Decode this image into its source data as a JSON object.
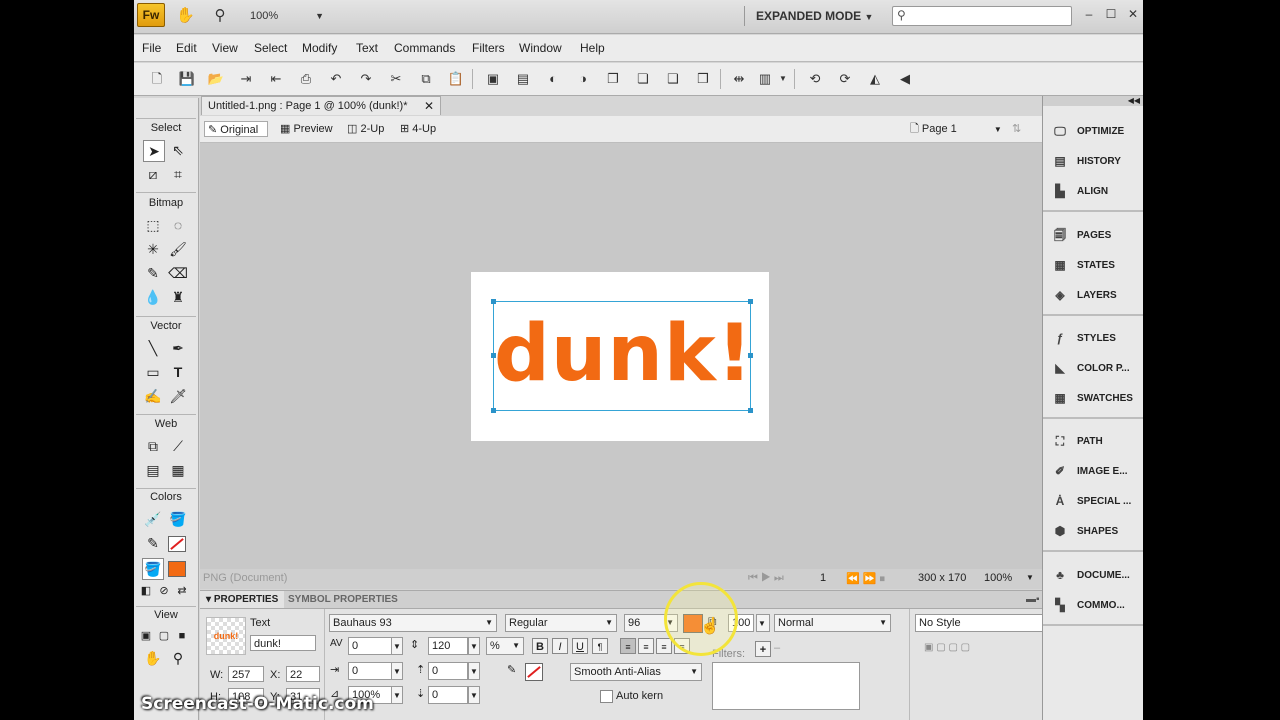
{
  "titlebar": {
    "logo": "Fw",
    "zoom": "100%",
    "mode": "EXPANDED MODE",
    "search_placeholder": ""
  },
  "menu": [
    "File",
    "Edit",
    "View",
    "Select",
    "Modify",
    "Text",
    "Commands",
    "Filters",
    "Window",
    "Help"
  ],
  "document": {
    "tab_title": "Untitled-1.png : Page 1 @ 100% (dunk!)*",
    "views": [
      "Original",
      "Preview",
      "2-Up",
      "4-Up"
    ],
    "page": "Page 1",
    "canvas_text": "dunk!",
    "text_color": "#f26a13"
  },
  "tools": {
    "sections": [
      "Select",
      "Bitmap",
      "Vector",
      "Web",
      "Colors",
      "View"
    ]
  },
  "statusbar": {
    "doc_type": "PNG (Document)",
    "frame": "1",
    "size": "300 x 170",
    "zoom": "100%"
  },
  "properties": {
    "tabs": [
      "PROPERTIES",
      "SYMBOL PROPERTIES"
    ],
    "object_type": "Text",
    "object_name": "dunk!",
    "thumb_text": "dunk!",
    "font": "Bauhaus 93",
    "style": "Regular",
    "size": "96",
    "opacity": "100",
    "blend": "Normal",
    "style_preset": "No Style",
    "kerning": "0",
    "leading": "120",
    "leading_unit": "%",
    "bold": "B",
    "italic": "I",
    "underline": "U",
    "indent": "0",
    "space_before": "0",
    "h_scale": "100%",
    "space_after": "0",
    "antialias": "Smooth Anti-Alias",
    "autokern": "Auto kern",
    "filters_label": "Filters:",
    "w_label": "W:",
    "w": "257",
    "x_label": "X:",
    "x": "22",
    "h_label": "H:",
    "h": "108",
    "y_label": "Y:",
    "y": "31"
  },
  "panels": [
    "OPTIMIZE",
    "HISTORY",
    "ALIGN",
    "PAGES",
    "STATES",
    "LAYERS",
    "STYLES",
    "COLOR P...",
    "SWATCHES",
    "PATH",
    "IMAGE E...",
    "SPECIAL ...",
    "SHAPES",
    "DOCUME...",
    "COMMO..."
  ],
  "watermark": "Screencast-O-Matic.com"
}
